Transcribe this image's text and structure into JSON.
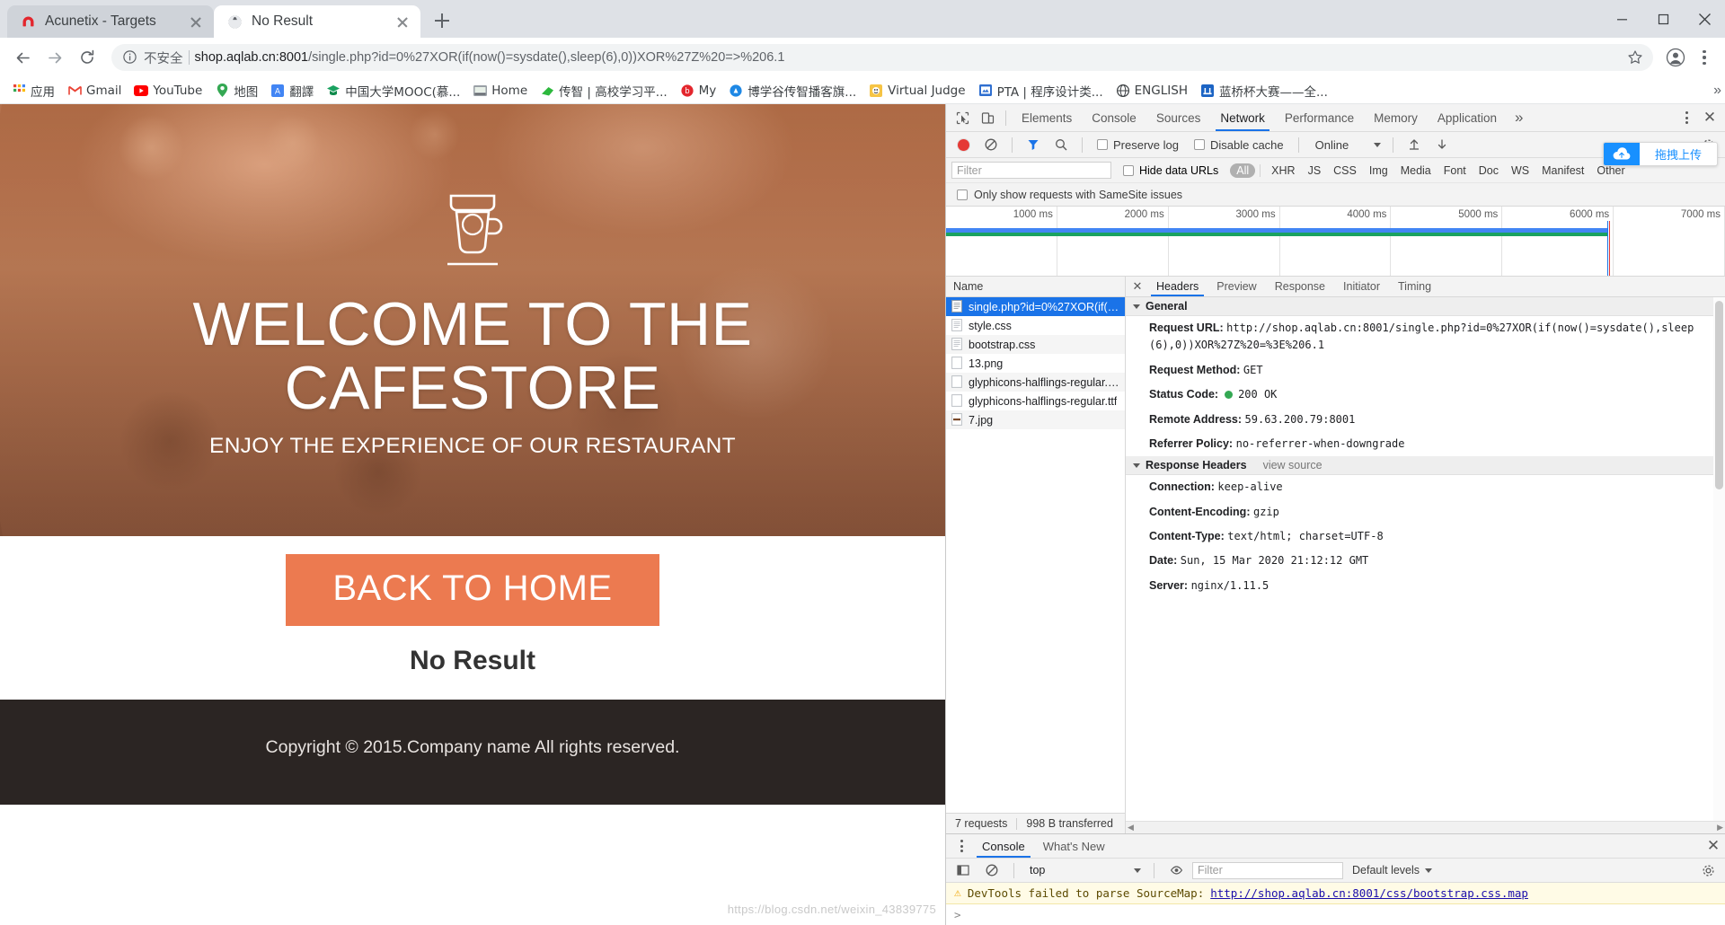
{
  "browser": {
    "tabs": [
      {
        "title": "Acunetix - Targets",
        "favicon": "acunetix-icon",
        "active": false
      },
      {
        "title": "No Result",
        "favicon": "globe-icon",
        "active": true
      }
    ],
    "new_tab_label": "+",
    "window_controls": {
      "minimize": "minimize-icon",
      "maximize": "maximize-icon",
      "close": "close-icon"
    },
    "nav": {
      "back": "back-arrow-icon",
      "forward": "forward-arrow-icon",
      "reload": "reload-icon",
      "security_icon": "info-circle-icon",
      "security_label": "不安全",
      "url_host": "shop.aqlab.cn:8001",
      "url_path": "/single.php?id=0%27XOR(if(now()=sysdate(),sleep(6),0))XOR%27Z%20=>%206.1",
      "bookmark_star": "star-icon",
      "profile": "profile-avatar-icon",
      "menu": "kebab-menu-icon"
    },
    "bookmarks": [
      {
        "label": "应用",
        "icon": "apps-grid-icon"
      },
      {
        "label": "Gmail",
        "icon": "gmail-icon"
      },
      {
        "label": "YouTube",
        "icon": "youtube-icon"
      },
      {
        "label": "地图",
        "icon": "maps-pin-icon"
      },
      {
        "label": "翻譯",
        "icon": "translate-icon"
      },
      {
        "label": "中国大学MOOC(慕...",
        "icon": "mooc-icon"
      },
      {
        "label": "Home",
        "icon": "home-folder-icon"
      },
      {
        "label": "传智 | 高校学习平...",
        "icon": "czbk-icon"
      },
      {
        "label": "My",
        "icon": "my-icon"
      },
      {
        "label": "博学谷传智播客旗...",
        "icon": "boxuegu-icon"
      },
      {
        "label": "Virtual Judge",
        "icon": "vjudge-icon"
      },
      {
        "label": "PTA | 程序设计类...",
        "icon": "pta-icon"
      },
      {
        "label": "ENGLISH",
        "icon": "globe-icon"
      },
      {
        "label": "蓝桥杯大赛——全...",
        "icon": "lanqiao-icon"
      }
    ],
    "bookmarks_overflow": "»"
  },
  "page": {
    "hero": {
      "logo_icon": "coffee-cup-icon",
      "heading": "WELCOME TO THE CAFESTORE",
      "subheading": "ENJOY THE EXPERIENCE OF OUR RESTAURANT"
    },
    "cta_label": "BACK TO HOME",
    "result_text": "No Result",
    "footer_text": "Copyright © 2015.Company name All rights reserved.",
    "watermark": "https://blog.csdn.net/weixin_43839775"
  },
  "devtools": {
    "main_tabs": [
      {
        "label": "Elements",
        "selected": false
      },
      {
        "label": "Console",
        "selected": false
      },
      {
        "label": "Sources",
        "selected": false
      },
      {
        "label": "Network",
        "selected": true
      },
      {
        "label": "Performance",
        "selected": false
      },
      {
        "label": "Memory",
        "selected": false
      },
      {
        "label": "Application",
        "selected": false
      }
    ],
    "inspect_icon": "inspect-cursor-icon",
    "device_icon": "device-toolbar-icon",
    "more_tabs": "»",
    "settings_dots": "kebab-menu-icon",
    "close_label": "✕",
    "network_toolbar": {
      "record_icon": "record-button-icon",
      "clear_icon": "clear-icon",
      "filter_icon": "filter-funnel-icon",
      "search_icon": "search-icon",
      "preserve_log": "Preserve log",
      "disable_cache": "Disable cache",
      "throttle_value": "Online",
      "import_icon": "import-har-icon",
      "export_icon": "export-har-icon",
      "settings_icon": "gear-icon"
    },
    "filter_row": {
      "filter_placeholder": "Filter",
      "hide_data_urls": "Hide data URLs",
      "types": [
        "All",
        "XHR",
        "JS",
        "CSS",
        "Img",
        "Media",
        "Font",
        "Doc",
        "WS",
        "Manifest",
        "Other"
      ],
      "selected_type": "All"
    },
    "samesite_label": "Only show requests with SameSite issues",
    "overview_ticks": [
      "1000 ms",
      "2000 ms",
      "3000 ms",
      "4000 ms",
      "5000 ms",
      "6000 ms",
      "7000 ms"
    ],
    "requests_column": "Name",
    "requests": [
      {
        "name": "single.php?id=0%27XOR(if(no...",
        "icon": "document-icon",
        "selected": true
      },
      {
        "name": "style.css",
        "icon": "stylesheet-icon",
        "selected": false
      },
      {
        "name": "bootstrap.css",
        "icon": "stylesheet-icon",
        "selected": false
      },
      {
        "name": "13.png",
        "icon": "image-icon",
        "selected": false
      },
      {
        "name": "glyphicons-halflings-regular.w...",
        "icon": "font-icon",
        "selected": false
      },
      {
        "name": "glyphicons-halflings-regular.ttf",
        "icon": "font-icon",
        "selected": false
      },
      {
        "name": "7.jpg",
        "icon": "image-icon",
        "selected": false
      }
    ],
    "footer": {
      "requests": "7 requests",
      "transferred": "998 B transferred"
    },
    "detail_tabs": [
      {
        "label": "Headers",
        "selected": true
      },
      {
        "label": "Preview",
        "selected": false
      },
      {
        "label": "Response",
        "selected": false
      },
      {
        "label": "Initiator",
        "selected": false
      },
      {
        "label": "Timing",
        "selected": false
      }
    ],
    "general_section": "General",
    "general": [
      {
        "key": "Request URL:",
        "value": "http://shop.aqlab.cn:8001/single.php?id=0%27XOR(if(now()=sysdate(),sleep(6),0))XOR%27Z%20=%3E%206.1"
      },
      {
        "key": "Request Method:",
        "value": "GET"
      },
      {
        "key": "Status Code:",
        "value": "200 OK",
        "status": "ok"
      },
      {
        "key": "Remote Address:",
        "value": "59.63.200.79:8001"
      },
      {
        "key": "Referrer Policy:",
        "value": "no-referrer-when-downgrade"
      }
    ],
    "response_section": "Response Headers",
    "view_source": "view source",
    "response_headers": [
      {
        "key": "Connection:",
        "value": "keep-alive"
      },
      {
        "key": "Content-Encoding:",
        "value": "gzip"
      },
      {
        "key": "Content-Type:",
        "value": "text/html; charset=UTF-8"
      },
      {
        "key": "Date:",
        "value": "Sun, 15 Mar 2020 21:12:12 GMT"
      },
      {
        "key": "Server:",
        "value": "nginx/1.11.5"
      }
    ],
    "drawer": {
      "tabs": [
        {
          "label": "Console",
          "selected": true
        },
        {
          "label": "What's New",
          "selected": false
        }
      ],
      "close_label": "✕",
      "menu_icon": "kebab-menu-icon",
      "toolbar": {
        "sidebar_icon": "console-sidebar-icon",
        "clear_icon": "clear-console-icon",
        "context_value": "top",
        "eye_icon": "live-expression-icon",
        "filter_placeholder": "Filter",
        "levels_value": "Default levels",
        "settings_icon": "gear-icon"
      },
      "messages": [
        {
          "icon": "warning-icon",
          "text": "DevTools failed to parse SourceMap: ",
          "link": "http://shop.aqlab.cn:8001/css/bootstrap.css.map"
        }
      ],
      "prompt": ">"
    },
    "upload_badge": {
      "icon": "cloud-upload-icon",
      "label": "拖拽上传"
    }
  },
  "colors": {
    "accent_blue": "#1a73e8",
    "cta_orange": "#ec7a50",
    "status_green": "#34a853",
    "record_red": "#e53935",
    "warn_bg": "#fffbe6"
  }
}
